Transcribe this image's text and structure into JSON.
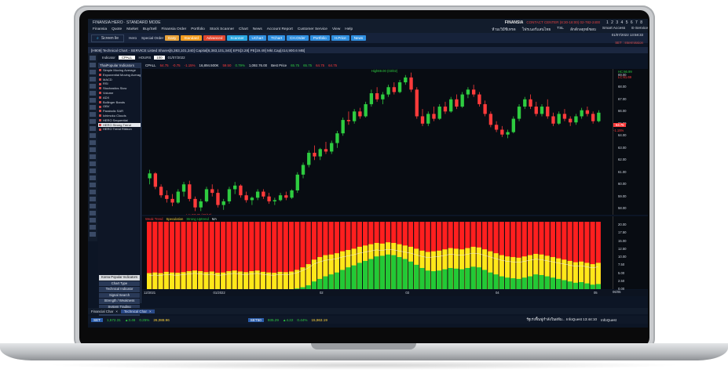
{
  "titlebar": {
    "app_title": "FINANSIA HERO · STANDARD MODE",
    "brand": "FINANSIA",
    "server": "CONTACT CENTER (8:30-18:00) 02-782-2400",
    "pages": "1 2 3 4 5 6 7 8"
  },
  "menu": [
    "Finansia",
    "Quote",
    "Market",
    "Buy/Sell",
    "Finansia Order",
    "Portfolio",
    "Stock Scanner",
    "Chart",
    "News",
    "Account Report",
    "Customer Service",
    "View",
    "Help"
  ],
  "menu_right": [
    "ห้ามเวิมีชีเทรด",
    "โฟรเนอร์แสนไทย",
    "TSL",
    "ลักต์กลยุทธ์ชอบ",
    "Smart Access",
    "E-Service"
  ],
  "toolbar": {
    "search_label": "Screen lie",
    "hero": "Hero",
    "special_order": "Special Order",
    "buttons": [
      {
        "label": "Easy",
        "color": "#e8a23a"
      },
      {
        "label": "Standard",
        "color": "#f29c1f"
      },
      {
        "label": "Advanced",
        "color": "#e0462e"
      },
      {
        "label": "Scanner",
        "color": "#29a7e1"
      },
      {
        "label": "UChart",
        "color": "#2f8fe0"
      },
      {
        "label": "TChart",
        "color": "#2f8fe0"
      },
      {
        "label": "CH.Order",
        "color": "#2f8fe0"
      },
      {
        "label": "Portfolio",
        "color": "#2f8fe0"
      },
      {
        "label": "H.Price",
        "color": "#2f8fe0"
      },
      {
        "label": "News",
        "color": "#2f8fe0"
      }
    ],
    "date": "01/07/2022",
    "time": "13:58:33",
    "set_status": "SET : Intermission"
  },
  "chart_window": {
    "title": "[H909] Technical Chart - SERVICE Listed Shares[6,383,101,340] Capital[6,383,101,340] EPS[3.28] PE[19.49] Mkt.Cap[414,900.6 MB]",
    "indicator_label": "Indicator",
    "symbol": "CPALL",
    "interval": "HOURS",
    "quote": {
      "symbol": "CPALL",
      "last": "64.75",
      "change": "-0.75",
      "pct": "-1.15%",
      "volume": "16,894.500K",
      "open": "59.50",
      "pct2": "0.79%",
      "value": "1,092.76.00",
      "best": "Best Price",
      "o": "65.75",
      "h": "65.75",
      "l": "64.75",
      "c": "64.75"
    },
    "date_field": "01/07/2022",
    "count": "100"
  },
  "indicators": {
    "header": "ThaiPopular Indicators",
    "items": [
      "Simple Moving Average",
      "Exponential Moving Average",
      "MACD",
      "RSI",
      "Stochastics Slow",
      "Volume",
      "ADX",
      "Bollinger Bands",
      "OBV",
      "Parabolic SAR",
      "Ichimoku Clouds",
      "HERO Sequential",
      "HERO Strong Trend",
      "HERO Trend Ribbon"
    ],
    "selected": "HERO Strong Trend",
    "bottom": [
      "Korea Popular Indicators",
      "Chart Type",
      "Technical Indicator",
      "Signal Search",
      "Strength / Weakness",
      "System Trading",
      "My Indicators"
    ]
  },
  "price_axis": {
    "ticks": [
      "69.00",
      "68.00",
      "67.00",
      "66.00",
      "65.00",
      "64.00",
      "63.00",
      "62.00",
      "61.00",
      "60.00",
      "59.00",
      "58.00"
    ],
    "markers": {
      "hc": "HC:66.99",
      "lc": "LC:61.69",
      "last": "64.75",
      "last_pct": "-1.15%"
    }
  },
  "annotations": {
    "high": "High69.00 (03/02)",
    "low": "Low57.75 (20/12)"
  },
  "sub_chart": {
    "legend": [
      {
        "label": "Weak Trend",
        "color": "#ff3b3b"
      },
      {
        "label": "Speculation",
        "color": "#ffd43b"
      },
      {
        "label": "Strong Uptrend",
        "color": "#2ecc40"
      },
      {
        "label": "MA",
        "color": "#e6e9ee"
      }
    ],
    "ticks": [
      "20.00",
      "17.50",
      "15.00",
      "12.50",
      "10.00",
      "7.50",
      "5.00",
      "2.50",
      "0.00"
    ]
  },
  "date_axis": [
    "12/2021",
    "01/2022",
    "02",
    "03",
    "04",
    "05"
  ],
  "date_axis_end": "06/05",
  "chart_data": {
    "type": "candlestick",
    "y_range": [
      57.5,
      69.5
    ],
    "candles": [
      [
        60.5,
        61.2,
        60.0,
        60.9
      ],
      [
        60.9,
        61.0,
        59.6,
        59.8
      ],
      [
        59.8,
        60.0,
        58.9,
        59.1
      ],
      [
        59.1,
        59.5,
        58.5,
        58.8
      ],
      [
        58.8,
        59.2,
        58.2,
        58.5
      ],
      [
        58.5,
        59.6,
        58.4,
        59.4
      ],
      [
        59.4,
        60.2,
        59.0,
        60.0
      ],
      [
        60.0,
        60.3,
        58.6,
        58.8
      ],
      [
        58.8,
        59.0,
        57.8,
        58.1
      ],
      [
        58.1,
        58.8,
        57.8,
        58.6
      ],
      [
        58.6,
        59.8,
        58.5,
        59.6
      ],
      [
        59.6,
        60.0,
        59.0,
        59.3
      ],
      [
        59.3,
        59.6,
        58.1,
        58.3
      ],
      [
        58.3,
        58.8,
        57.9,
        58.6
      ],
      [
        58.6,
        59.8,
        58.4,
        59.6
      ],
      [
        59.6,
        60.2,
        59.2,
        59.9
      ],
      [
        59.9,
        60.0,
        58.9,
        59.1
      ],
      [
        59.1,
        59.4,
        58.5,
        58.7
      ],
      [
        58.7,
        59.0,
        58.3,
        58.9
      ],
      [
        58.9,
        59.6,
        58.7,
        59.4
      ],
      [
        59.4,
        59.6,
        58.8,
        59.0
      ],
      [
        59.0,
        59.3,
        58.4,
        58.6
      ],
      [
        58.6,
        58.9,
        58.3,
        58.7
      ],
      [
        58.7,
        59.3,
        58.6,
        59.1
      ],
      [
        59.1,
        59.4,
        58.7,
        58.9
      ],
      [
        58.9,
        59.6,
        58.8,
        59.5
      ],
      [
        59.5,
        61.0,
        59.3,
        60.8
      ],
      [
        60.8,
        61.8,
        60.5,
        61.6
      ],
      [
        61.6,
        62.8,
        61.4,
        62.6
      ],
      [
        62.6,
        63.2,
        62.0,
        62.3
      ],
      [
        62.3,
        63.0,
        62.0,
        62.9
      ],
      [
        62.9,
        63.5,
        62.5,
        62.7
      ],
      [
        62.7,
        63.6,
        62.5,
        63.4
      ],
      [
        63.4,
        64.4,
        63.0,
        64.2
      ],
      [
        64.2,
        65.5,
        64.0,
        65.3
      ],
      [
        65.3,
        66.0,
        64.9,
        65.2
      ],
      [
        65.2,
        66.2,
        65.0,
        66.0
      ],
      [
        66.0,
        66.3,
        65.4,
        65.6
      ],
      [
        65.6,
        66.8,
        65.5,
        66.6
      ],
      [
        66.6,
        67.8,
        66.4,
        67.5
      ],
      [
        67.5,
        68.0,
        66.8,
        67.0
      ],
      [
        67.0,
        67.6,
        66.6,
        67.4
      ],
      [
        67.4,
        68.2,
        67.2,
        68.0
      ],
      [
        68.0,
        68.4,
        67.4,
        67.6
      ],
      [
        67.6,
        68.6,
        67.5,
        68.4
      ],
      [
        68.4,
        69.0,
        68.2,
        68.8
      ],
      [
        68.8,
        69.2,
        67.6,
        67.8
      ],
      [
        67.8,
        68.0,
        65.4,
        65.6
      ],
      [
        65.6,
        66.2,
        64.8,
        65.0
      ],
      [
        65.0,
        66.0,
        64.8,
        65.8
      ],
      [
        65.8,
        66.4,
        65.2,
        65.4
      ],
      [
        65.4,
        66.6,
        65.3,
        66.4
      ],
      [
        66.4,
        66.8,
        65.8,
        66.0
      ],
      [
        66.0,
        67.2,
        65.9,
        67.0
      ],
      [
        67.0,
        67.4,
        66.2,
        66.4
      ],
      [
        66.4,
        67.6,
        66.3,
        67.4
      ],
      [
        67.4,
        68.0,
        67.1,
        67.8
      ],
      [
        67.8,
        68.2,
        67.2,
        67.4
      ],
      [
        67.4,
        67.6,
        66.4,
        66.6
      ],
      [
        66.6,
        66.9,
        65.6,
        65.8
      ],
      [
        65.8,
        66.0,
        64.7,
        64.9
      ],
      [
        64.9,
        65.2,
        64.3,
        64.5
      ],
      [
        64.5,
        64.8,
        63.9,
        64.1
      ],
      [
        64.1,
        64.5,
        63.8,
        64.3
      ],
      [
        64.3,
        65.6,
        64.2,
        65.4
      ],
      [
        65.4,
        66.6,
        65.2,
        66.4
      ],
      [
        66.4,
        67.2,
        66.2,
        67.0
      ],
      [
        67.0,
        67.4,
        66.2,
        66.4
      ],
      [
        66.4,
        66.8,
        65.6,
        65.8
      ],
      [
        65.8,
        66.6,
        65.6,
        66.4
      ],
      [
        66.4,
        67.0,
        65.4,
        65.6
      ],
      [
        65.6,
        65.9,
        64.8,
        65.0
      ],
      [
        65.0,
        66.0,
        64.9,
        65.8
      ],
      [
        65.8,
        66.2,
        65.2,
        65.4
      ],
      [
        65.4,
        65.6,
        64.8,
        65.1
      ],
      [
        65.1,
        65.8,
        64.9,
        65.6
      ],
      [
        65.6,
        66.3,
        65.4,
        66.1
      ],
      [
        66.1,
        66.4,
        65.6,
        65.8
      ],
      [
        65.8,
        66.0,
        65.0,
        65.2
      ],
      [
        65.2,
        66.1,
        65.1,
        65.9
      ]
    ],
    "sub_series": {
      "name": "HERO Strong Trend",
      "total": [
        12.6,
        12.4,
        12.5,
        12.8,
        12.3,
        12.2,
        12.7,
        12.9,
        12.8,
        12.6,
        12.3,
        12.4,
        12.0,
        12.2,
        12.7,
        12.8,
        12.5,
        12.4,
        12.6,
        12.9,
        12.4,
        12.2,
        12.1,
        12.5,
        12.3,
        12.6,
        13.0,
        13.4,
        14.2,
        15.0,
        15.5,
        15.6,
        15.2,
        15.8,
        16.4,
        16.8,
        17.2,
        17.6,
        17.8,
        18.2,
        18.6,
        18.4,
        18.8,
        18.6,
        18.2,
        18.0,
        17.8,
        17.4,
        16.8,
        16.6,
        16.4,
        16.2,
        16.6,
        16.8,
        16.4,
        16.2,
        16.8,
        17.2,
        17.0,
        16.4,
        16.0,
        15.6,
        15.2,
        14.8,
        14.6,
        14.2,
        14.4,
        14.8,
        15.2,
        15.0,
        14.6,
        14.2,
        13.8,
        13.6,
        13.2,
        12.8,
        13.0,
        12.6,
        12.4,
        12.8
      ],
      "yellow": [
        5.0,
        5.2,
        5.0,
        5.4,
        5.2,
        5.1,
        5.3,
        5.6,
        5.8,
        5.6,
        5.3,
        5.5,
        5.1,
        5.2,
        5.6,
        5.8,
        5.5,
        5.3,
        5.6,
        5.8,
        5.4,
        5.2,
        5.1,
        5.4,
        5.3,
        5.5,
        6.0,
        6.8,
        7.8,
        9.2,
        10.0,
        10.6,
        10.8,
        11.2,
        11.8,
        12.2,
        12.6,
        13.2,
        13.6,
        14.0,
        14.4,
        14.2,
        14.6,
        14.4,
        14.0,
        13.6,
        13.2,
        12.6,
        12.0,
        11.6,
        11.8,
        12.0,
        12.4,
        12.8,
        12.6,
        12.4,
        12.8,
        13.2,
        13.0,
        12.4,
        11.8,
        11.2,
        10.6,
        10.2,
        10.0,
        9.8,
        10.2,
        10.6,
        11.0,
        10.8,
        10.4,
        10.0,
        9.6,
        9.2,
        8.8,
        8.4,
        8.6,
        8.2,
        7.8,
        8.2
      ],
      "green": [
        0,
        0,
        0,
        0,
        0,
        0,
        0,
        0,
        0,
        0,
        0,
        0,
        0,
        0,
        0,
        0,
        0,
        0,
        0,
        0,
        0,
        0,
        0,
        0,
        0,
        0,
        0.2,
        0.6,
        1.2,
        2.4,
        3.2,
        4.0,
        4.6,
        5.2,
        6.0,
        6.8,
        7.4,
        8.2,
        8.8,
        9.4,
        10.2,
        10.4,
        10.8,
        10.6,
        10.0,
        9.4,
        8.6,
        7.6,
        6.6,
        5.8,
        5.6,
        5.8,
        6.2,
        6.6,
        6.4,
        6.2,
        6.6,
        7.0,
        6.8,
        6.0,
        5.2,
        4.6,
        4.0,
        3.6,
        3.4,
        3.2,
        3.6,
        4.0,
        4.6,
        4.4,
        4.0,
        3.6,
        3.2,
        2.8,
        2.4,
        2.0,
        2.2,
        1.8,
        1.4,
        1.6
      ]
    }
  },
  "tabs": [
    "Financial Char",
    "Technical Char"
  ],
  "ticker": [
    {
      "idx": "SET",
      "value": "1,572.31",
      "chg": "▲3.46",
      "pct": "0.25%",
      "vol": "26,088.96"
    },
    {
      "idx": "SET50",
      "value": "935.29",
      "chg": "▲4.22",
      "pct": "0.44%",
      "vol": "15,863.19"
    }
  ],
  "news": "รัฐเร่งฟื้นฟูกำลังในฝห์ม... InfoQuest 13:44:10",
  "news_source": "InfoQuest"
}
